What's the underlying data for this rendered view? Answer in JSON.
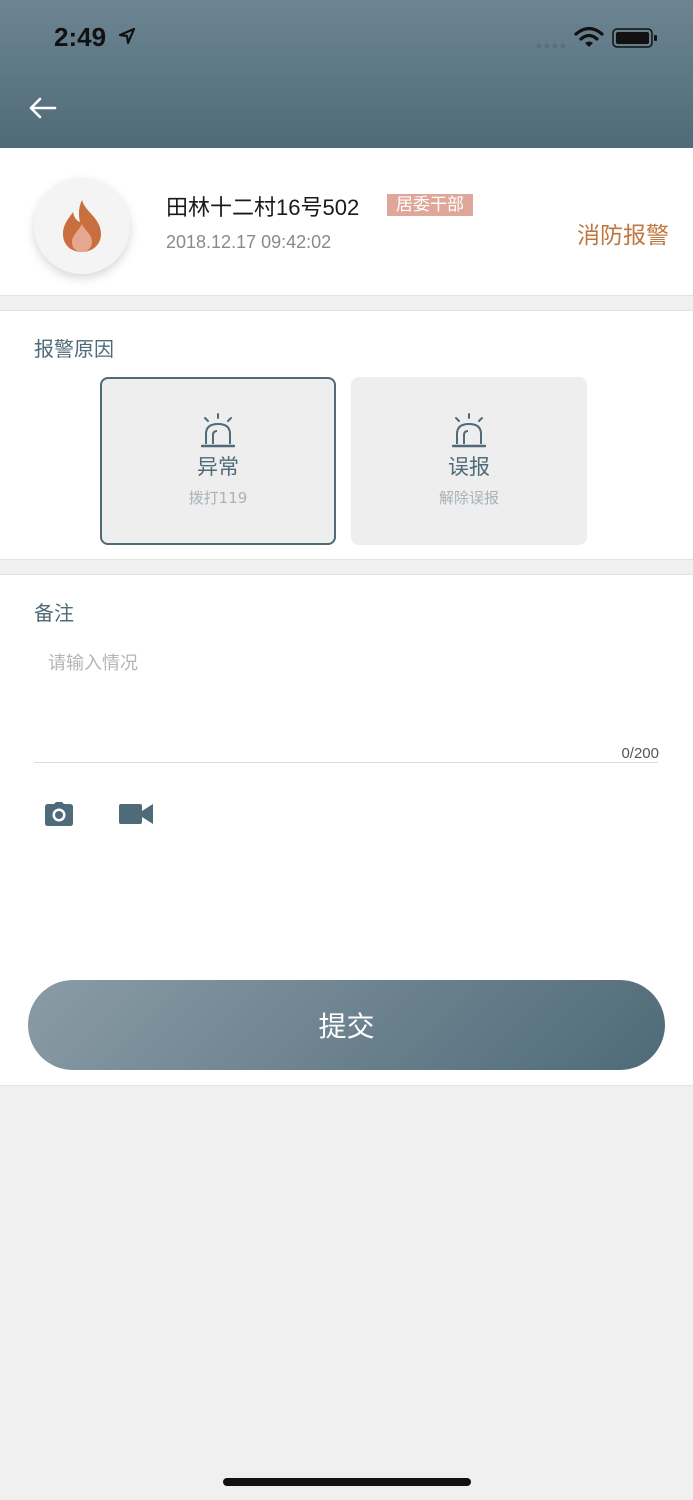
{
  "status_bar": {
    "time": "2:49"
  },
  "header": {
    "back_icon": "arrow-left-icon"
  },
  "incident": {
    "icon": "fire-icon",
    "address": "田林十二村16号502",
    "role_badge": "居委干部",
    "timestamp": "2018.12.17 09:42:02",
    "alarm_type": "消防报警",
    "accent_color": "#c0763f",
    "badge_color": "#dfa79a"
  },
  "reason": {
    "title": "报警原因",
    "options": [
      {
        "icon": "siren-icon",
        "label": "异常",
        "sub": "拨打119",
        "selected": true
      },
      {
        "icon": "siren-icon",
        "label": "误报",
        "sub": "解除误报",
        "selected": false
      }
    ]
  },
  "remark": {
    "title": "备注",
    "placeholder": "请输入情况",
    "value": "",
    "char_count": "0/200",
    "camera_icon": "camera-icon",
    "video_icon": "video-camera-icon"
  },
  "submit": {
    "label": "提交"
  },
  "theme": {
    "primary": "#4f6a78",
    "background": "#f0f0f0"
  }
}
